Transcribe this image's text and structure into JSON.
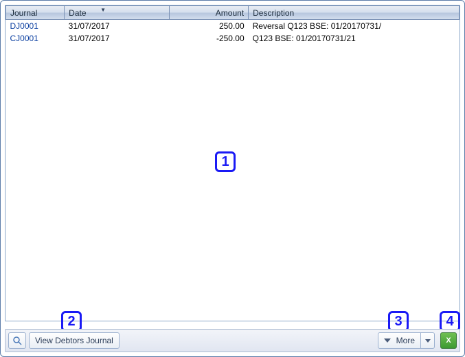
{
  "columns": {
    "journal": "Journal",
    "date": "Date",
    "amount": "Amount",
    "description": "Description"
  },
  "sorted_column": "date",
  "rows": [
    {
      "journal": "DJ0001",
      "date": "31/07/2017",
      "amount": "250.00",
      "description": "Reversal Q123 BSE: 01/20170731/"
    },
    {
      "journal": "CJ0001",
      "date": "31/07/2017",
      "amount": "-250.00",
      "description": "Q123 BSE: 01/20170731/21"
    }
  ],
  "toolbar": {
    "view_label": "View Debtors Journal",
    "more_label": "More"
  },
  "annotations": {
    "a1": "1",
    "a2": "2",
    "a3": "3",
    "a4": "4"
  },
  "icons": {
    "excel_glyph": "X"
  }
}
